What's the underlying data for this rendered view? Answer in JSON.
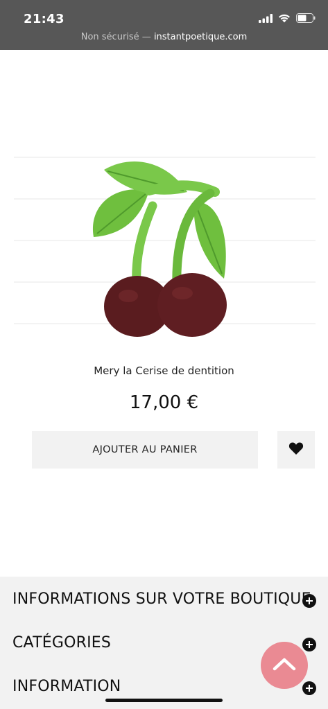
{
  "status_bar": {
    "time": "21:43",
    "url_prefix": "Non sécurisé — ",
    "url_host": "instantpoetique.com",
    "icons": [
      "signal-icon",
      "wifi-icon",
      "battery-icon"
    ]
  },
  "product": {
    "image_icon": "cherry-teether-image",
    "name": "Mery la Cerise de dentition",
    "price": "17,00 €",
    "add_to_cart_label": "AJOUTER AU PANIER",
    "wishlist_icon": "heart-icon"
  },
  "footer": {
    "sections": [
      {
        "label": "INFORMATIONS SUR VOTRE BOUTIQUE",
        "icon": "plus-circle-icon"
      },
      {
        "label": "CATÉGORIES",
        "icon": "plus-circle-icon"
      },
      {
        "label": "INFORMATION",
        "icon": "plus-circle-icon"
      }
    ]
  },
  "scroll_top": {
    "icon": "chevron-up-icon"
  },
  "colors": {
    "status_bar_bg": "#575757",
    "button_bg": "#f2f2f2",
    "footer_bg": "#f2f2f2",
    "scroll_top_bg": "#ea8a93",
    "cherry": "#5a1c1f",
    "leaf": "#6fbf3e"
  }
}
